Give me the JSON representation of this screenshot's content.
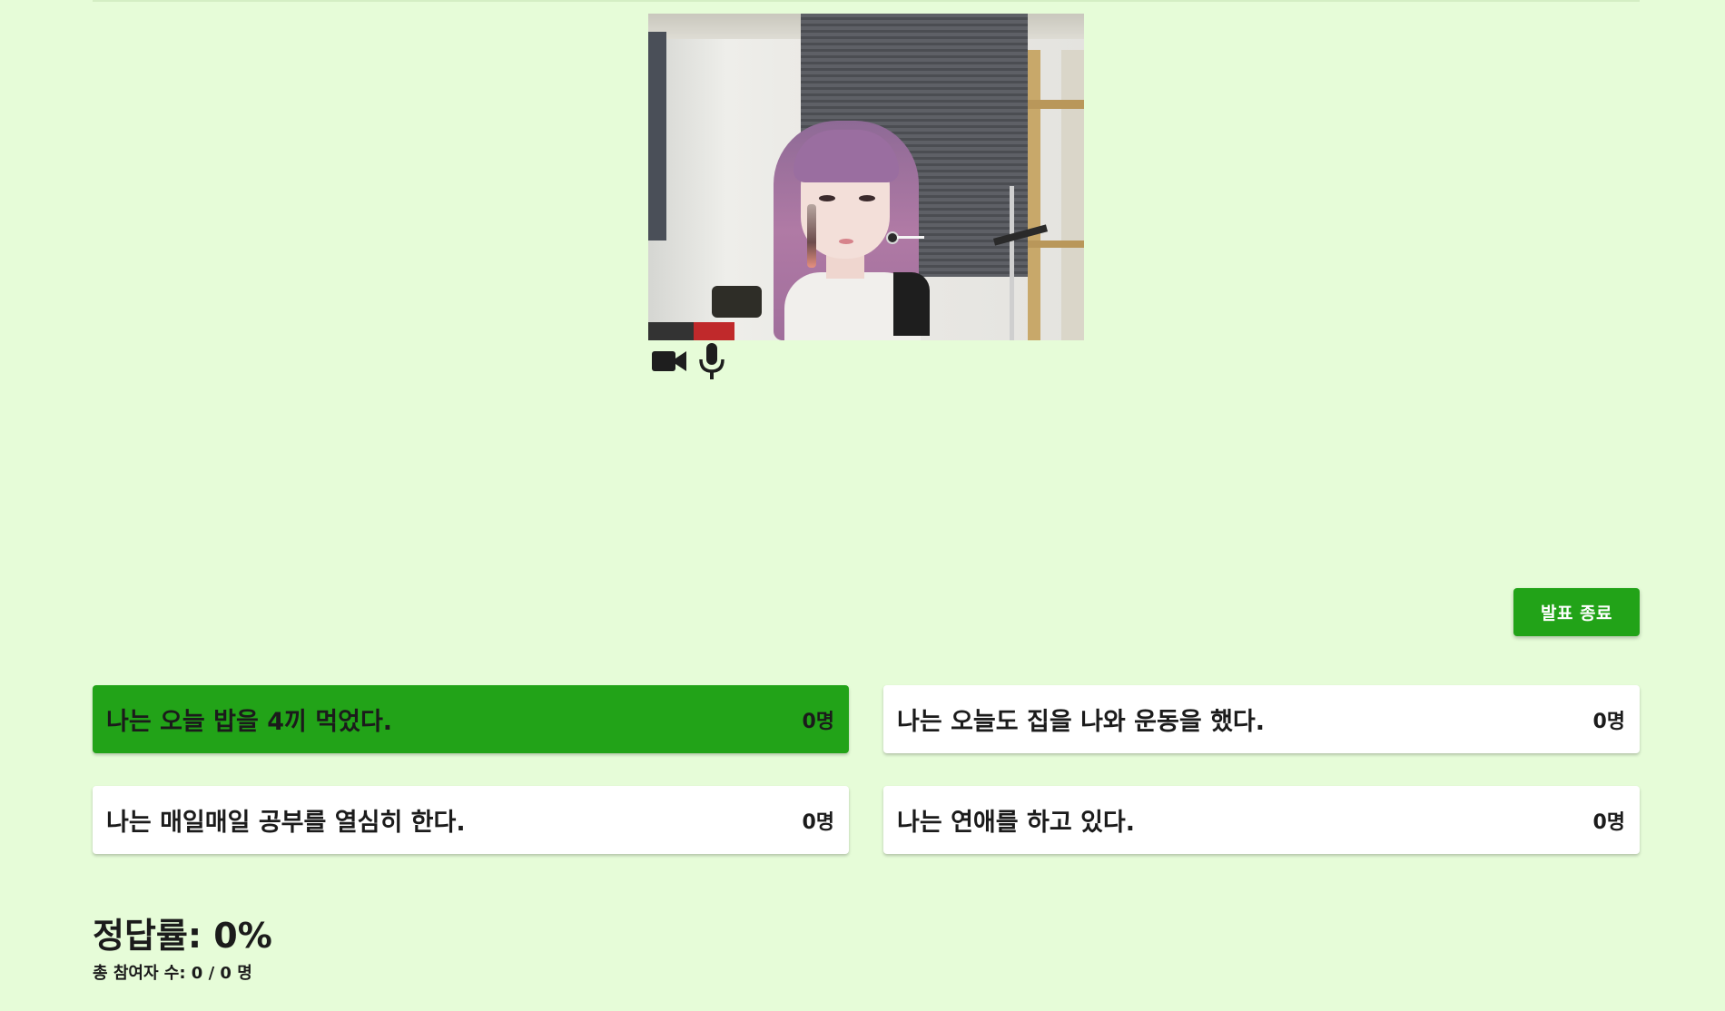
{
  "video": {
    "camera_icon": "video-camera-icon",
    "mic_icon": "microphone-icon"
  },
  "controls": {
    "end_presentation_label": "발표 종료"
  },
  "options": [
    {
      "text": "나는 오늘 밥을 4끼 먹었다.",
      "count": "0명",
      "selected": true
    },
    {
      "text": "나는 오늘도 집을 나와 운동을 했다.",
      "count": "0명",
      "selected": false
    },
    {
      "text": "나는 매일매일 공부를 열심히 한다.",
      "count": "0명",
      "selected": false
    },
    {
      "text": "나는 연애를 하고 있다.",
      "count": "0명",
      "selected": false
    }
  ],
  "stats": {
    "accuracy": "정답률: 0%",
    "participants": "총 참여자 수: 0 / 0 명"
  },
  "colors": {
    "background": "#e6fcd8",
    "accent": "#22a318",
    "card": "#ffffff"
  }
}
